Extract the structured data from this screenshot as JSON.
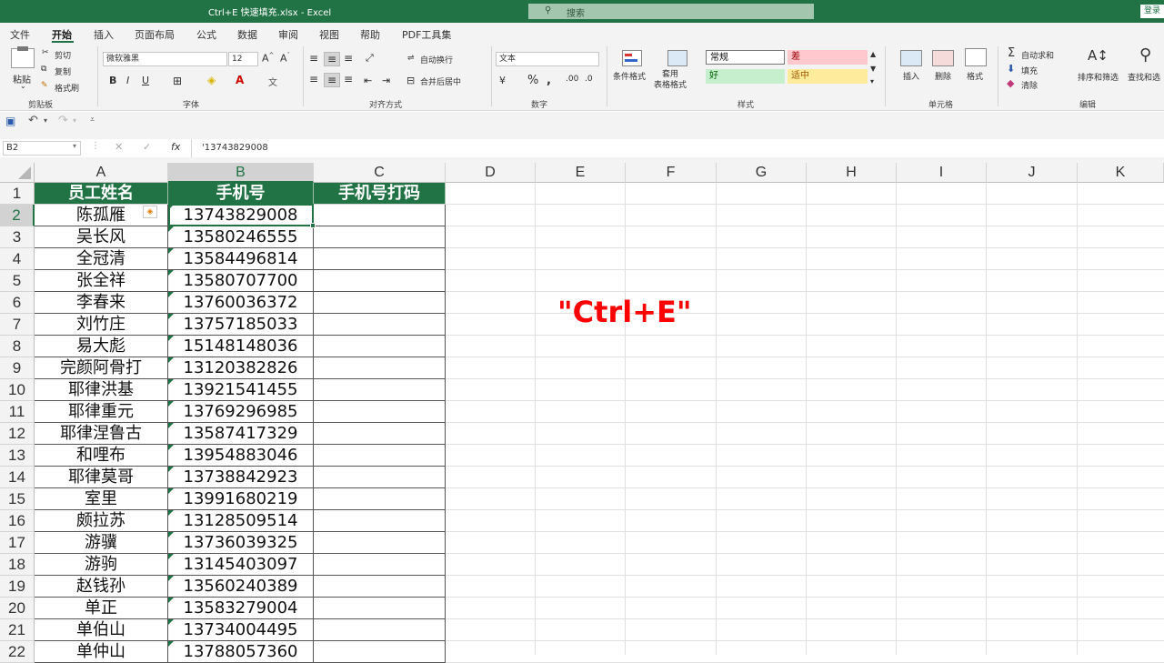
{
  "window": {
    "title": "Ctrl+E 快速填充.xlsx  -  Excel",
    "search_placeholder": "搜索",
    "login": "登录"
  },
  "menu": [
    "文件",
    "开始",
    "插入",
    "页面布局",
    "公式",
    "数据",
    "审阅",
    "视图",
    "帮助",
    "PDF工具集"
  ],
  "ribbon": {
    "clipboard": {
      "paste": "粘贴",
      "cut": "剪切",
      "copy": "复制",
      "format_painter": "格式刷",
      "label": "剪贴板"
    },
    "font": {
      "name": "微软雅黑",
      "size": "12",
      "label": "字体"
    },
    "alignment": {
      "wrap": "自动换行",
      "merge": "合并后居中",
      "label": "对齐方式"
    },
    "number": {
      "format": "文本",
      "label": "数字"
    },
    "styles": {
      "conditional": "条件格式",
      "table_format": "套用\n表格格式",
      "normal": "常规",
      "bad": "差",
      "good": "好",
      "neutral": "适中",
      "label": "样式"
    },
    "cells": {
      "insert": "插入",
      "delete": "删除",
      "format": "格式",
      "label": "单元格"
    },
    "editing": {
      "autosum": "自动求和",
      "fill": "填充",
      "clear": "清除",
      "sort": "排序和筛选",
      "find": "查找和选",
      "label": "编辑"
    }
  },
  "formula_bar": {
    "name_box": "B2",
    "fx": "fx",
    "content": "'13743829008"
  },
  "columns": [
    "A",
    "B",
    "C",
    "D",
    "E",
    "F",
    "G",
    "H",
    "I",
    "J",
    "K"
  ],
  "headers": [
    "员工姓名",
    "手机号",
    "手机号打码"
  ],
  "rows": [
    {
      "num": "2",
      "name": "陈孤雁",
      "phone": "13743829008"
    },
    {
      "num": "3",
      "name": "吴长风",
      "phone": "13580246555"
    },
    {
      "num": "4",
      "name": "全冠清",
      "phone": "13584496814"
    },
    {
      "num": "5",
      "name": "张全祥",
      "phone": "13580707700"
    },
    {
      "num": "6",
      "name": "李春来",
      "phone": "13760036372"
    },
    {
      "num": "7",
      "name": "刘竹庄",
      "phone": "13757185033"
    },
    {
      "num": "8",
      "name": "易大彪",
      "phone": "15148148036"
    },
    {
      "num": "9",
      "name": "完颜阿骨打",
      "phone": "13120382826"
    },
    {
      "num": "10",
      "name": "耶律洪基",
      "phone": "13921541455"
    },
    {
      "num": "11",
      "name": "耶律重元",
      "phone": "13769296985"
    },
    {
      "num": "12",
      "name": "耶律涅鲁古",
      "phone": "13587417329"
    },
    {
      "num": "13",
      "name": "和哩布",
      "phone": "13954883046"
    },
    {
      "num": "14",
      "name": "耶律莫哥",
      "phone": "13738842923"
    },
    {
      "num": "15",
      "name": "室里",
      "phone": "13991680219"
    },
    {
      "num": "16",
      "name": "颇拉苏",
      "phone": "13128509514"
    },
    {
      "num": "17",
      "name": "游骥",
      "phone": "13736039325"
    },
    {
      "num": "18",
      "name": "游驹",
      "phone": "13145403097"
    },
    {
      "num": "19",
      "name": "赵钱孙",
      "phone": "13560240389"
    },
    {
      "num": "20",
      "name": "单正",
      "phone": "13583279004"
    },
    {
      "num": "21",
      "name": "单伯山",
      "phone": "13734004495"
    },
    {
      "num": "22",
      "name": "单仲山",
      "phone": "13788057360"
    }
  ],
  "overlay_text": "\"Ctrl+E\"",
  "colors": {
    "excel_green": "#217346",
    "overlay_red": "#ff0000"
  }
}
